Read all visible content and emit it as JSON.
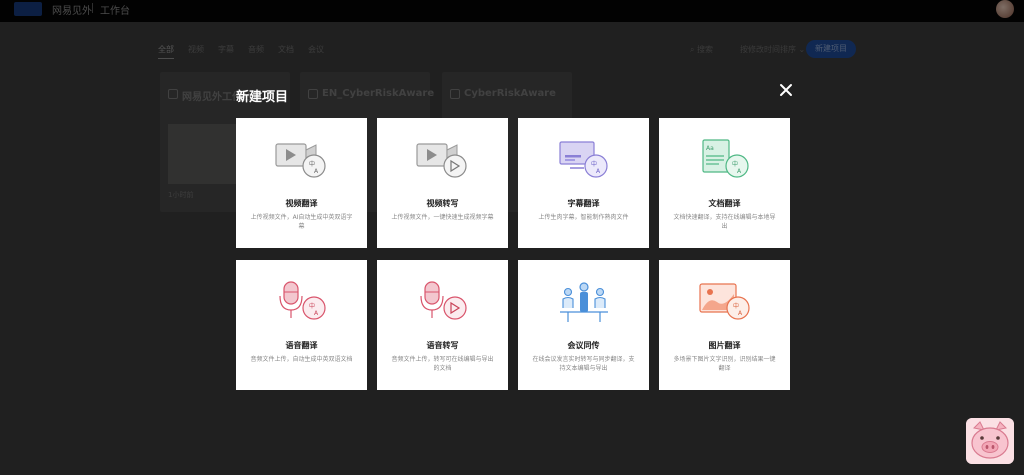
{
  "header": {
    "brand": "网易见外",
    "workspace": "工作台"
  },
  "background": {
    "tabs": [
      "全部",
      "视频",
      "字幕",
      "音频",
      "文档",
      "会议"
    ],
    "search_label": "搜索",
    "sort_label": "按修改时间排序",
    "new_button": "新建项目",
    "cards": [
      {
        "title": "网易见外工作台",
        "foot": "1小时前"
      },
      {
        "title": "EN_CyberRiskAware",
        "foot": ""
      },
      {
        "title": "CyberRiskAware",
        "foot": ""
      }
    ]
  },
  "modal": {
    "title": "新建项目",
    "items": [
      {
        "icon": "video-translate-icon",
        "title": "视频翻译",
        "desc": "上传视频文件，AI自动生成中英双语字幕"
      },
      {
        "icon": "video-transcribe-icon",
        "title": "视频转写",
        "desc": "上传视频文件，一键快速生成视频字幕"
      },
      {
        "icon": "subtitle-translate-icon",
        "title": "字幕翻译",
        "desc": "上传生肉字幕，智能制作熟肉文件"
      },
      {
        "icon": "document-translate-icon",
        "title": "文档翻译",
        "desc": "文档快速翻译，支持在线编辑与本地导出"
      },
      {
        "icon": "audio-translate-icon",
        "title": "语音翻译",
        "desc": "音频文件上传，自动生成中英双语文档"
      },
      {
        "icon": "audio-transcribe-icon",
        "title": "语音转写",
        "desc": "音频文件上传，转写可在线编辑与导出的文档"
      },
      {
        "icon": "meeting-interpretation-icon",
        "title": "会议同传",
        "desc": "在线会议发言实时转写与同步翻译，支持文本编辑与导出"
      },
      {
        "icon": "image-translate-icon",
        "title": "图片翻译",
        "desc": "多场景下图片文字识别，识别结果一键翻译"
      }
    ]
  },
  "colors": {
    "accent_blue": "#1e4a96",
    "overlay": "#000000",
    "card_bg": "#ffffff"
  }
}
